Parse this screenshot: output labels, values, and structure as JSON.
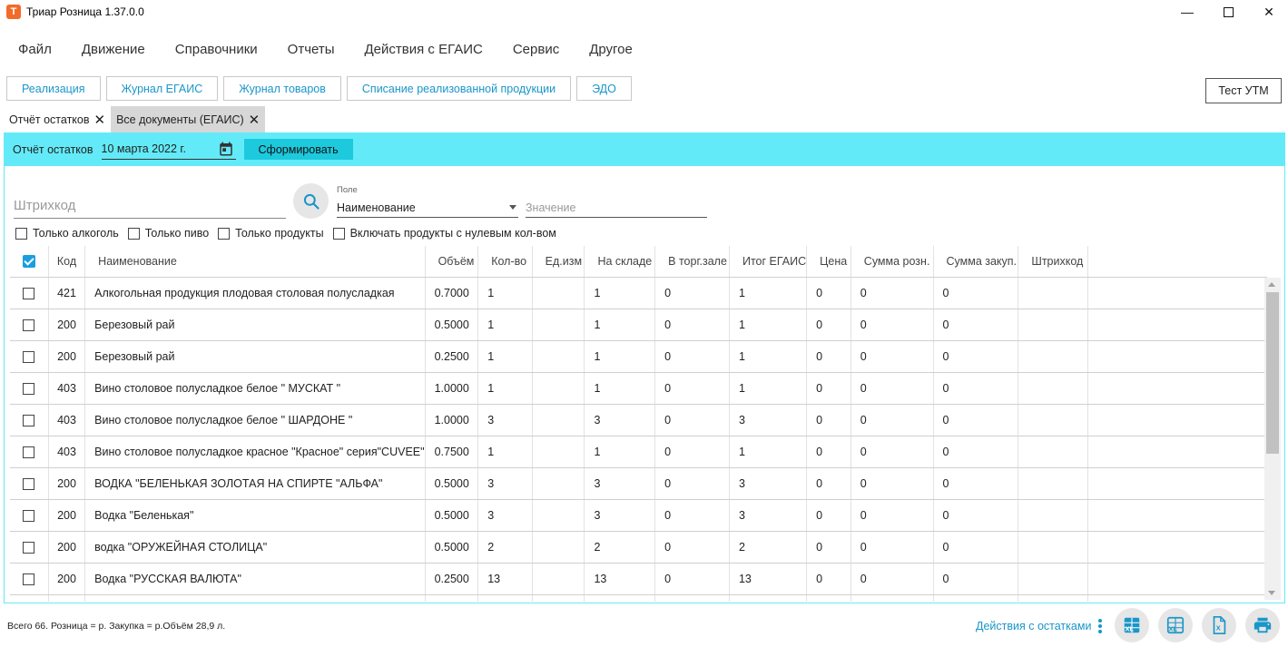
{
  "window": {
    "app_icon_letter": "T",
    "title": "Триар Розница 1.37.0.0",
    "minimize": "—",
    "close": "✕"
  },
  "menu": [
    "Файл",
    "Движение",
    "Справочники",
    "Отчеты",
    "Действия с ЕГАИС",
    "Сервис",
    "Другое"
  ],
  "quick_buttons": [
    "Реализация",
    "Журнал ЕГАИС",
    "Журнал товаров",
    "Списание реализованной продукции",
    "ЭДО"
  ],
  "test_button": "Тест УТМ",
  "tabs": [
    {
      "label": "Отчёт остатков",
      "active": false
    },
    {
      "label": "Все документы (ЕГАИС)",
      "active": true
    }
  ],
  "report_bar": {
    "label": "Отчёт остатков",
    "date": "10 марта 2022 г.",
    "generate_label": "Сформировать",
    "color": "#63eaf8",
    "button_color": "#1cc9dd"
  },
  "search": {
    "barcode_placeholder": "Штрихкод",
    "field_caption": "Поле",
    "field_value": "Наименование",
    "value_placeholder": "Значение"
  },
  "filters": [
    "Только алкоголь",
    "Только пиво",
    "Только продукты",
    "Включать продукты с нулевым кол-вом"
  ],
  "table": {
    "columns": [
      "Код",
      "Наименование",
      "Объём",
      "Кол-во",
      "Ед.изм",
      "На складе",
      "В торг.зале",
      "Итог ЕГАИС",
      "Цена",
      "Сумма розн.",
      "Сумма закуп.",
      "Штрихкод"
    ],
    "rows": [
      {
        "code": "421",
        "name": "Алкогольная продукция плодовая столовая полусладкая",
        "volume": "0.7000",
        "qty": "1",
        "unit": "",
        "stock": "1",
        "hall": "0",
        "egais": "1",
        "price": "0",
        "retail": "0",
        "purchase": "0",
        "barcode": ""
      },
      {
        "code": "200",
        "name": "Березовый рай",
        "volume": "0.5000",
        "qty": "1",
        "unit": "",
        "stock": "1",
        "hall": "0",
        "egais": "1",
        "price": "0",
        "retail": "0",
        "purchase": "0",
        "barcode": ""
      },
      {
        "code": "200",
        "name": "Березовый рай",
        "volume": "0.2500",
        "qty": "1",
        "unit": "",
        "stock": "1",
        "hall": "0",
        "egais": "1",
        "price": "0",
        "retail": "0",
        "purchase": "0",
        "barcode": ""
      },
      {
        "code": "403",
        "name": "Вино столовое полусладкое белое \" МУСКАТ \"",
        "volume": "1.0000",
        "qty": "1",
        "unit": "",
        "stock": "1",
        "hall": "0",
        "egais": "1",
        "price": "0",
        "retail": "0",
        "purchase": "0",
        "barcode": ""
      },
      {
        "code": "403",
        "name": "Вино столовое полусладкое белое \" ШАРДОНЕ \"",
        "volume": "1.0000",
        "qty": "3",
        "unit": "",
        "stock": "3",
        "hall": "0",
        "egais": "3",
        "price": "0",
        "retail": "0",
        "purchase": "0",
        "barcode": ""
      },
      {
        "code": "403",
        "name": "Вино столовое полусладкое красное \"Красное\" серия\"CUVEE\"",
        "volume": "0.7500",
        "qty": "1",
        "unit": "",
        "stock": "1",
        "hall": "0",
        "egais": "1",
        "price": "0",
        "retail": "0",
        "purchase": "0",
        "barcode": ""
      },
      {
        "code": "200",
        "name": "ВОДКА \"БЕЛЕНЬКАЯ ЗОЛОТАЯ НА СПИРТЕ \"АЛЬФА\"",
        "volume": "0.5000",
        "qty": "3",
        "unit": "",
        "stock": "3",
        "hall": "0",
        "egais": "3",
        "price": "0",
        "retail": "0",
        "purchase": "0",
        "barcode": ""
      },
      {
        "code": "200",
        "name": "Водка \"Беленькая\"",
        "volume": "0.5000",
        "qty": "3",
        "unit": "",
        "stock": "3",
        "hall": "0",
        "egais": "3",
        "price": "0",
        "retail": "0",
        "purchase": "0",
        "barcode": ""
      },
      {
        "code": "200",
        "name": "водка \"ОРУЖЕЙНАЯ СТОЛИЦА\"",
        "volume": "0.5000",
        "qty": "2",
        "unit": "",
        "stock": "2",
        "hall": "0",
        "egais": "2",
        "price": "0",
        "retail": "0",
        "purchase": "0",
        "barcode": ""
      },
      {
        "code": "200",
        "name": "Водка \"РУССКАЯ ВАЛЮТА\"",
        "volume": "0.2500",
        "qty": "13",
        "unit": "",
        "stock": "13",
        "hall": "0",
        "egais": "13",
        "price": "0",
        "retail": "0",
        "purchase": "0",
        "barcode": ""
      },
      {
        "code": "",
        "name": "",
        "volume": "",
        "qty": "",
        "unit": "",
        "stock": "",
        "hall": "",
        "egais": "",
        "price": "",
        "retail": "",
        "purchase": "",
        "barcode": ""
      }
    ]
  },
  "footer": {
    "status": "Всего 66. Розница = р. Закупка = р.Объём 28,9 л.",
    "actions_label": "Действия с остатками",
    "buttons": [
      {
        "icon": "excel-export-icon",
        "label": "XL"
      },
      {
        "icon": "excel-export-outline-icon",
        "label": "XL"
      },
      {
        "icon": "excel-file-icon",
        "label": "X"
      },
      {
        "icon": "print-icon",
        "label": ""
      }
    ],
    "accent": "#1a96c8"
  }
}
